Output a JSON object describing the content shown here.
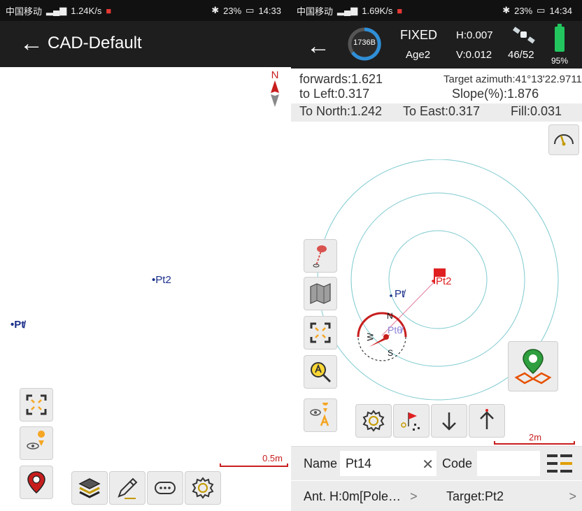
{
  "left": {
    "status": {
      "carrier": "中国移动",
      "speed": "1.24K/s",
      "battery": "23%",
      "time": "14:33"
    },
    "title": "CAD-Default",
    "north": "N",
    "points": [
      {
        "label": "Pt2"
      },
      {
        "label": "Pt̸"
      }
    ],
    "scale": "0.5m",
    "colors": {
      "point": "#1a2f8a",
      "scale": "#c81e1e",
      "locate": "#c81e1e"
    }
  },
  "right": {
    "status": {
      "carrier": "中国移动",
      "speed": "1.69K/s",
      "battery": "23%",
      "time": "14:34"
    },
    "header": {
      "counter": "1736B",
      "solution": "FIXED",
      "h_acc": "H:0.007",
      "age": "Age2",
      "v_acc": "V:0.012",
      "satellites": "46/52",
      "battery": "95%"
    },
    "info": {
      "forwards": "forwards:1.621",
      "target_azimuth": "Target azimuth:41°13'22.9711\"",
      "to_left": "to Left:0.317",
      "slope": "Slope(%):1.876",
      "to_north": "To North:1.242",
      "to_east": "To East:0.317",
      "fill": "Fill:0.031"
    },
    "map": {
      "pt_target": "Pt2",
      "pt_other": "Pt̸",
      "pt_current": "Ptθ̸",
      "compass": {
        "n": "N",
        "s": "S",
        "w": "W"
      }
    },
    "scale": "2m",
    "form": {
      "name_label": "Name",
      "name_value": "Pt14",
      "clear": "✕",
      "code_label": "Code",
      "code_value": ""
    },
    "bottom": {
      "antenna": "Ant. H:0m[Pole…",
      "antenna_chevron": ">",
      "target": "Target:Pt2",
      "target_chevron": ">"
    },
    "colors": {
      "accent": "#2e7d32",
      "flag": "#e02020",
      "rings": "#7fcad0",
      "compass": "#c81e1e"
    }
  }
}
